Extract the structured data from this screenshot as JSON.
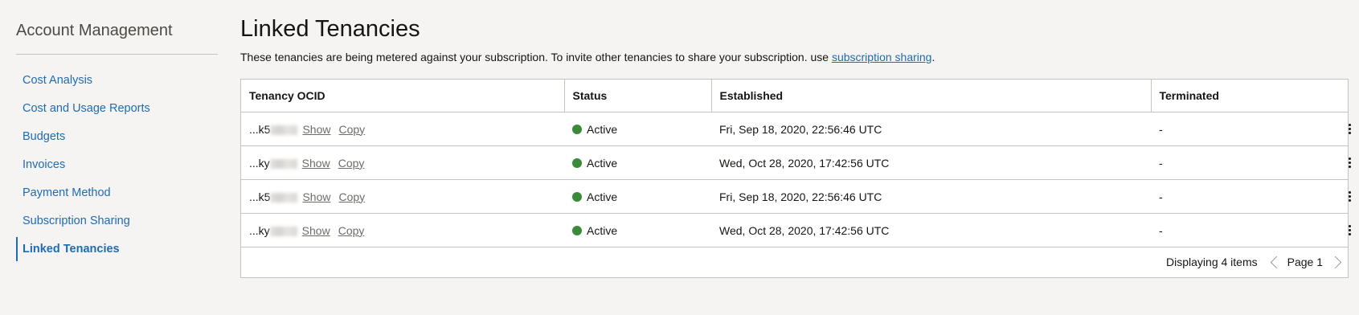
{
  "sidebar": {
    "title": "Account Management",
    "items": [
      {
        "label": "Cost Analysis"
      },
      {
        "label": "Cost and Usage Reports"
      },
      {
        "label": "Budgets"
      },
      {
        "label": "Invoices"
      },
      {
        "label": "Payment Method"
      },
      {
        "label": "Subscription Sharing"
      },
      {
        "label": "Linked Tenancies",
        "active": true
      }
    ]
  },
  "main": {
    "title": "Linked Tenancies",
    "description": "These tenancies are being metered against your subscription. To invite other tenancies to share your subscription. use ",
    "description_link": "subscription sharing",
    "description_end": "."
  },
  "table": {
    "columns": [
      "Tenancy OCID",
      "Status",
      "Established",
      "Terminated",
      ""
    ],
    "show_label": "Show",
    "copy_label": "Copy",
    "rows": [
      {
        "ocid": "...k5",
        "status": "Active",
        "established": "Fri, Sep 18, 2020, 22:56:46 UTC",
        "terminated": "-"
      },
      {
        "ocid": "...ky",
        "status": "Active",
        "established": "Wed, Oct 28, 2020, 17:42:56 UTC",
        "terminated": "-"
      },
      {
        "ocid": "...k5",
        "status": "Active",
        "established": "Fri, Sep 18, 2020, 22:56:46 UTC",
        "terminated": "-"
      },
      {
        "ocid": "...ky",
        "status": "Active",
        "established": "Wed, Oct 28, 2020, 17:42:56 UTC",
        "terminated": "-"
      }
    ],
    "footer": {
      "count": "Displaying 4 items",
      "page": "Page 1"
    }
  },
  "colors": {
    "accent": "#1f6bb3",
    "status_active": "#3a8a3a",
    "background": "#f5f4f2"
  }
}
